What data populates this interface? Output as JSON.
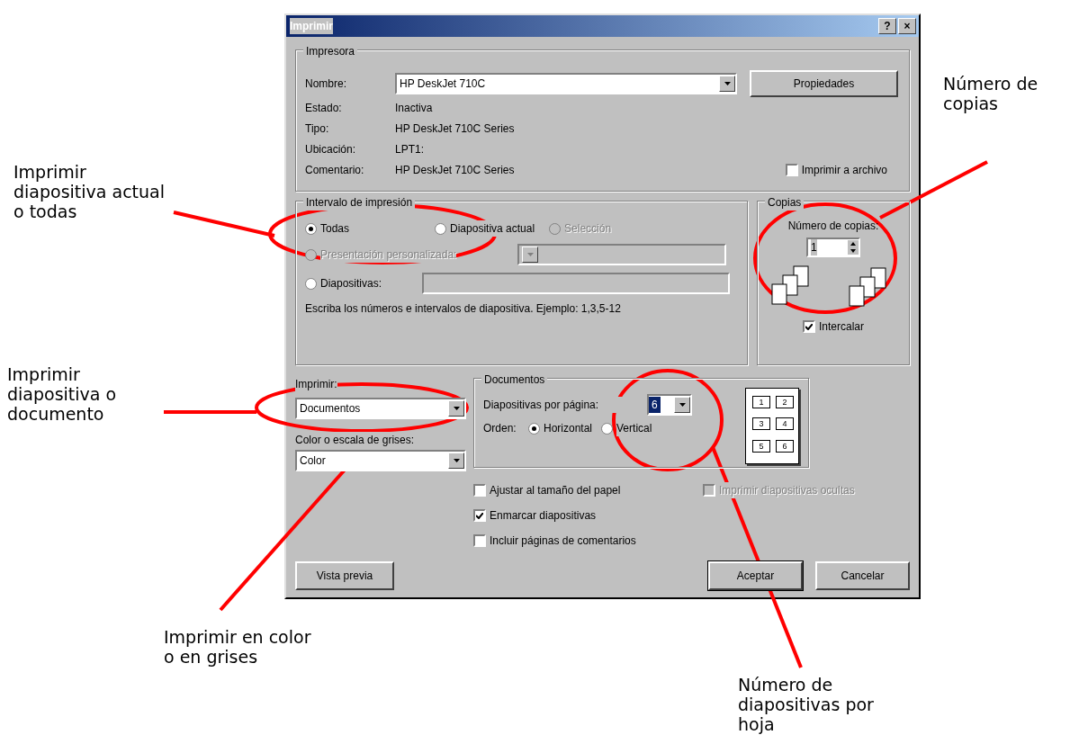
{
  "window": {
    "title": "Imprimir",
    "controls": [
      "?",
      "×"
    ]
  },
  "printer": {
    "legend": "Impresora",
    "name_label": "Nombre:",
    "name_value": "HP DeskJet 710C",
    "properties_button": "Propiedades",
    "info": [
      {
        "label": "Estado:",
        "value": "Inactiva"
      },
      {
        "label": "Tipo:",
        "value": "HP DeskJet 710C Series"
      },
      {
        "label": "Ubicación:",
        "value": "LPT1:"
      },
      {
        "label": "Comentario:",
        "value": "HP DeskJet 710C Series"
      }
    ],
    "print_to_file": {
      "label": "Imprimir a archivo",
      "checked": false
    }
  },
  "range": {
    "legend": "Intervalo de impresión",
    "options": [
      {
        "label": "Todas",
        "selected": true,
        "disabled": false
      },
      {
        "label": "Diapositiva actual",
        "selected": false,
        "disabled": false
      },
      {
        "label": "Selección",
        "selected": false,
        "disabled": true
      }
    ],
    "custom": {
      "label": "Presentación personalizada:",
      "selected": false,
      "disabled": true
    },
    "slides": {
      "label": "Diapositivas:",
      "selected": false,
      "disabled": false
    },
    "hint": "Escriba los números e intervalos de diapositiva. Ejemplo: 1,3,5-12"
  },
  "copies": {
    "legend": "Copias",
    "label": "Número de copias:",
    "value": "1",
    "collate": {
      "label": "Intercalar",
      "checked": true
    }
  },
  "print_what": {
    "label": "Imprimir:",
    "value": "Documentos"
  },
  "color_mode": {
    "label": "Color o escala de grises:",
    "value": "Color"
  },
  "documents": {
    "legend": "Documentos",
    "per_page_label": "Diapositivas por página:",
    "per_page_value": "6",
    "order_label": "Orden:",
    "order_options": [
      {
        "label": "Horizontal",
        "selected": true
      },
      {
        "label": "Vertical",
        "selected": false
      }
    ],
    "preview_pages": [
      "1",
      "2",
      "3",
      "4",
      "5",
      "6"
    ]
  },
  "options": [
    {
      "label": "Ajustar al tamaño del papel",
      "checked": false,
      "disabled": false
    },
    {
      "label": "Imprimir diapositivas ocultas",
      "checked": false,
      "disabled": true
    },
    {
      "label": "Enmarcar diapositivas",
      "checked": true,
      "disabled": false
    },
    {
      "label": "Incluir páginas de comentarios",
      "checked": false,
      "disabled": false
    }
  ],
  "buttons": [
    {
      "label": "Vista previa"
    },
    {
      "label": "Aceptar"
    },
    {
      "label": "Cancelar"
    }
  ],
  "annotations": [
    {
      "lines": [
        "Imprimir",
        "diapositiva actual",
        "o todas"
      ]
    },
    {
      "lines": [
        "Imprimir",
        "diapositiva o",
        "documento"
      ]
    },
    {
      "lines": [
        "Imprimir en color",
        "o en grises"
      ]
    },
    {
      "lines": [
        "Número de",
        "copias"
      ]
    },
    {
      "lines": [
        "Número de",
        "diapositivas por",
        "hoja"
      ]
    }
  ]
}
